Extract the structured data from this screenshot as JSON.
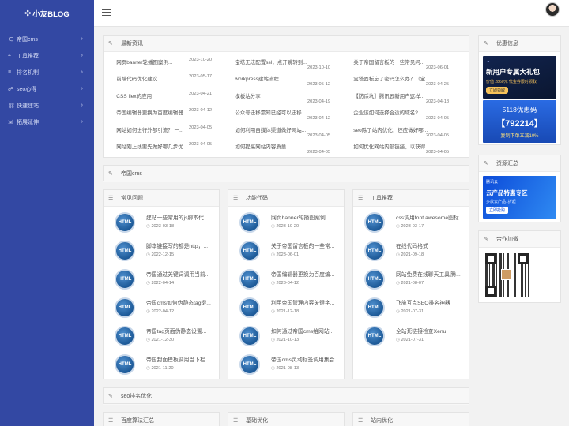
{
  "logo": "小友BLOG",
  "nav": [
    {
      "icon": "share-icon",
      "label": "帝国cms"
    },
    {
      "icon": "tool-icon",
      "label": "工具推荐"
    },
    {
      "icon": "rank-icon",
      "label": "排名机制"
    },
    {
      "icon": "seo-icon",
      "label": "seo心得"
    },
    {
      "icon": "link-icon",
      "label": "快速建站"
    },
    {
      "icon": "expand-icon",
      "label": "拓展延伸"
    }
  ],
  "news": {
    "title": "最新资讯",
    "col1": [
      {
        "t": "网页banner轮播图案例...",
        "d": "2023-10-20"
      },
      {
        "t": "前端代码优化建议",
        "d": "2023-05-17"
      },
      {
        "t": "CSS flex的应用",
        "d": "2023-04-21"
      },
      {
        "t": "帝国编辑器更换为百度编辑器...",
        "d": "2023-04-12"
      },
      {
        "t": "网站如何进行外部引流？ 一...",
        "d": "2023-04-05"
      },
      {
        "t": "网站刚上线要先做好哪几步优...",
        "d": "2023-04-05"
      }
    ],
    "col2": [
      {
        "t": "宝塔无法配置ssl，点开跳转到...",
        "d": "2023-10-10"
      },
      {
        "t": "workpress建站流程",
        "d": "2023-05-12"
      },
      {
        "t": "模板站分享",
        "d": "2023-04-19"
      },
      {
        "t": "公众号迁移需知已经可以迁移...",
        "d": "2023-04-12"
      },
      {
        "t": "如何利用自媒体渠道做好网站...",
        "d": "2023-04-05"
      },
      {
        "t": "如何提高网站内容质量...",
        "d": "2023-04-05"
      }
    ],
    "col3": [
      {
        "t": "关于帝国留言板的一些常见问...",
        "d": "2023-06-01"
      },
      {
        "t": "宝塔面板忘了密码怎么办？（宝塔...",
        "d": "2023-04-25"
      },
      {
        "t": "【防踩坑】腾讯云新用户这样...",
        "d": "2023-04-18"
      },
      {
        "t": "企业该如何选择合适的域名?",
        "d": "2023-04-05"
      },
      {
        "t": "seo除了站内优化，还应做好哪...",
        "d": "2023-04-05"
      },
      {
        "t": "如何优化网站内部链接，以获得...",
        "d": "2023-04-05"
      }
    ]
  },
  "section1": "帝国cms",
  "boxes": [
    {
      "title": "常见问题",
      "items": [
        {
          "t": "建站一些常用的js脚本代...",
          "d": "2023-03-18"
        },
        {
          "t": "脚本链接写的都是http，...",
          "d": "2022-12-15"
        },
        {
          "t": "帝国通过关键词调用当前...",
          "d": "2022-04-14"
        },
        {
          "t": "帝国cms如何伪静态tag键...",
          "d": "2022-04-12"
        },
        {
          "t": "帝国tag页面伪静态设置...",
          "d": "2021-12-30"
        },
        {
          "t": "帝国封面模板调用当下栏...",
          "d": "2021-11-20"
        }
      ]
    },
    {
      "title": "功能代码",
      "items": [
        {
          "t": "网页banner轮播图案例",
          "d": "2023-10-20"
        },
        {
          "t": "关于帝国留言板的一些常...",
          "d": "2023-06-01"
        },
        {
          "t": "帝国编辑器更换为百度编...",
          "d": "2023-04-12"
        },
        {
          "t": "利用帝国管理内容关键字...",
          "d": "2021-12-18"
        },
        {
          "t": "如何通过帝国cms给网站...",
          "d": "2021-10-13"
        },
        {
          "t": "帝国cms灵动标签调用集合",
          "d": "2021-08-13"
        }
      ]
    },
    {
      "title": "工具推荐",
      "items": [
        {
          "t": "css调用font awesome图标",
          "d": "2023-03-17"
        },
        {
          "t": "在线代码格式",
          "d": "2021-09-18"
        },
        {
          "t": "网站免费在线聊天工具'腾...",
          "d": "2021-08-07"
        },
        {
          "t": "飞施互点SEO排名神器",
          "d": "2021-07-31"
        },
        {
          "t": "全站死链接检查Xenu",
          "d": "2021-07-31"
        }
      ]
    }
  ],
  "icon_text": "HTML",
  "section2": "seo排名优化",
  "boxes2": [
    "百度算法汇总",
    "基础优化",
    "站内优化"
  ],
  "side": {
    "promo": "优惠信息",
    "ad1_line1": "新用户专属大礼包",
    "ad1_line2": "价值 2860元 代金券限时领取",
    "ad1_btn": "立即领取",
    "ad2_line1": "5118优惠码",
    "ad2_line2": "【792214】",
    "ad2_line3": "复制下单立减10%",
    "res": "资源汇总",
    "ad3_brand": "腾讯云",
    "ad3_line1": "云产品特惠专区",
    "ad3_line2": "多款云产品1折起",
    "ad3_btn": "立即抢购",
    "coop": "合作加微"
  }
}
